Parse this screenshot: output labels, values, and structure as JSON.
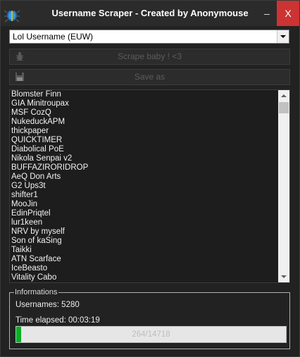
{
  "window": {
    "title": "Username Scraper - Created by Anonymouse",
    "close_glyph": "X",
    "app_icon": "bug-icon"
  },
  "region_select": {
    "value": "Lol Username (EUW)"
  },
  "toolbar": {
    "scrape_label": "Scrape baby ! <3",
    "scrape_icon": "bug-icon",
    "save_label": "Save as",
    "save_icon": "floppy-disk-icon"
  },
  "usernames": [
    "Blomster Finn",
    "GIA Minitroupax",
    "MSF CozQ",
    "NukeduckAPM",
    "thickpaper",
    "QUICKTIMER",
    "Diabolical PoE",
    "Nikola Senpai v2",
    "BUFFAZIRORIDROP",
    "AeQ Don Arts",
    "G2 Ups3t",
    "shifter1",
    "MooJin",
    "EdinPriqtel",
    "lur1keen",
    "NRV by myself",
    "Son of kaSing",
    "Taikki",
    "ATN Scarface",
    "IceBeasto",
    "Vitality Cabo"
  ],
  "info": {
    "legend": "Informations",
    "usernames_text": "Usernames: 5280",
    "time_text": "Time elapsed: 00:03:19",
    "progress_text": "264/14718",
    "progress_fraction": 0.0179
  },
  "colors": {
    "close_button": "#cc3333",
    "progress_fill": "#06b025"
  }
}
